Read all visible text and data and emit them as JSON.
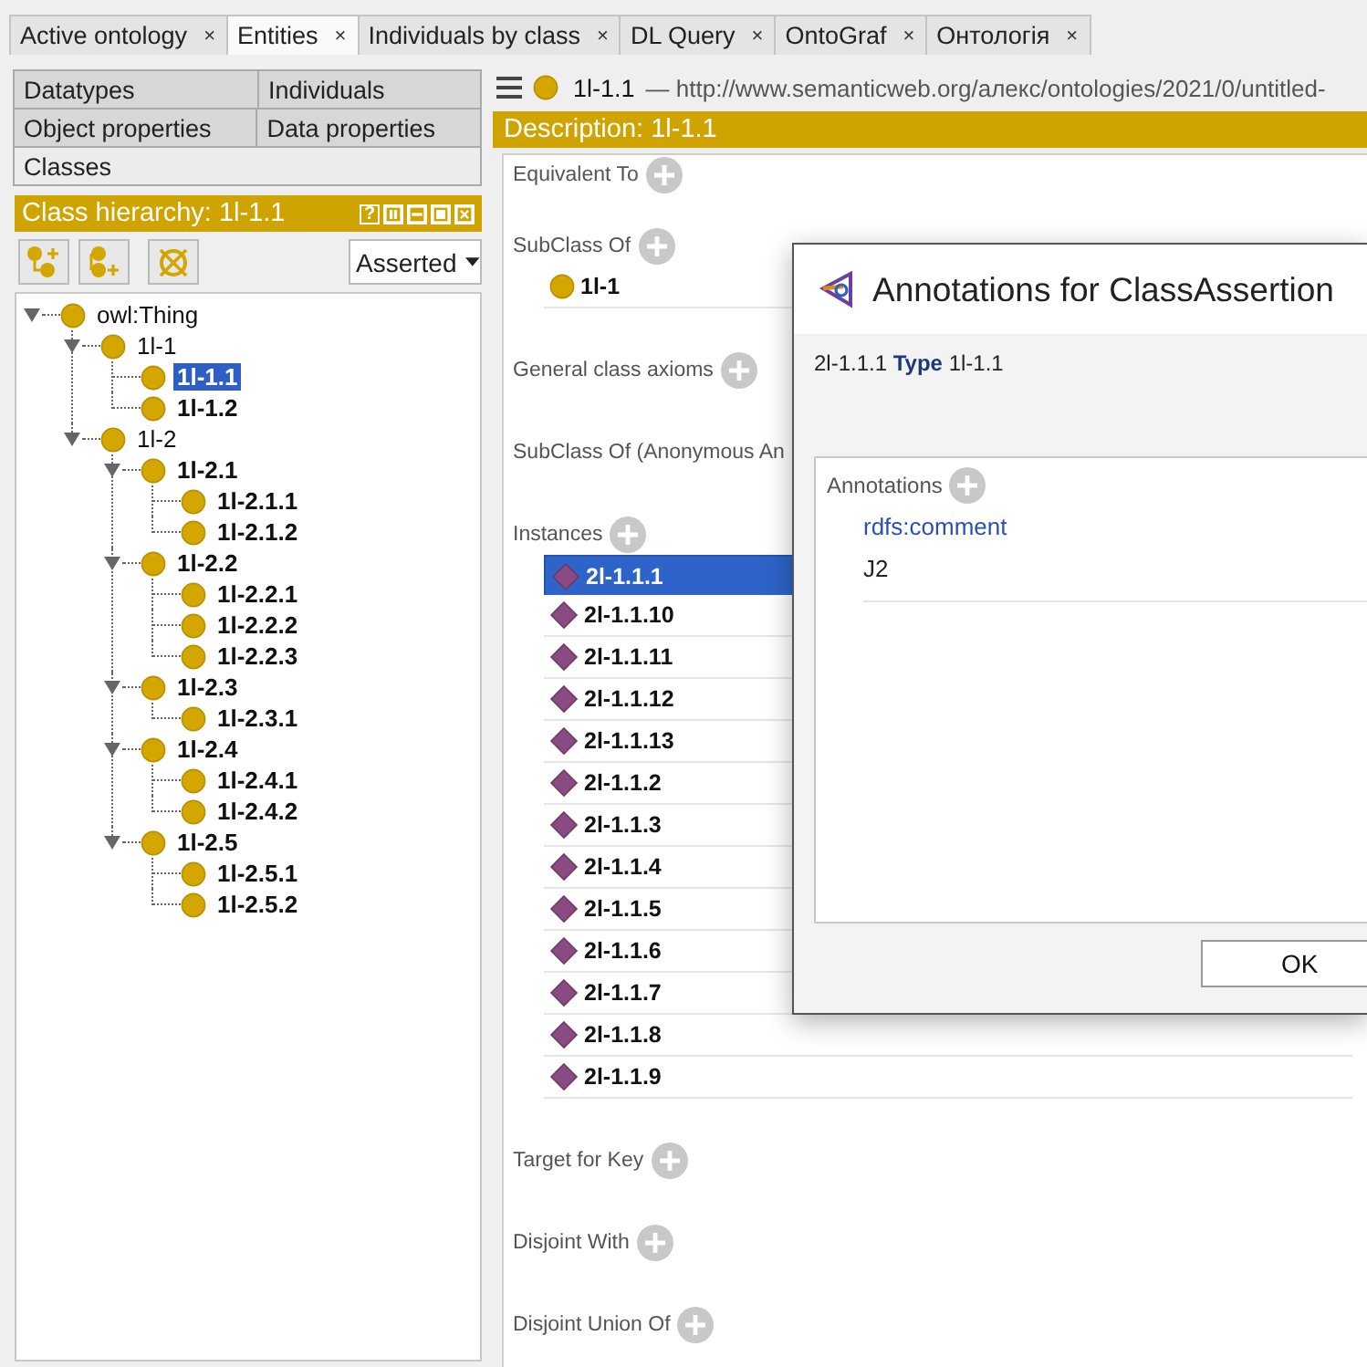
{
  "tabs": [
    {
      "label": "Active ontology",
      "close": "×",
      "selected": false
    },
    {
      "label": "Entities",
      "close": "×",
      "selected": true
    },
    {
      "label": "Individuals by class",
      "close": "×",
      "selected": false
    },
    {
      "label": "DL Query",
      "close": "×",
      "selected": false
    },
    {
      "label": "OntoGraf",
      "close": "×",
      "selected": false
    },
    {
      "label": "Онтологія",
      "close": "×",
      "selected": false
    }
  ],
  "entity_tabs": [
    {
      "tabs": [
        {
          "label": "Datatypes",
          "selected": false
        },
        {
          "label": "Individuals",
          "selected": false
        }
      ]
    },
    {
      "tabs": [
        {
          "label": "Object properties",
          "selected": false
        },
        {
          "label": "Data properties",
          "selected": false
        }
      ]
    },
    {
      "tabs": [
        {
          "label": "Classes",
          "selected": true
        }
      ]
    }
  ],
  "class_hierarchy": {
    "title": "Class hierarchy: 1l-1.1",
    "help_button": "?",
    "mode": "Asserted",
    "tree": [
      {
        "label": "owl:Thing",
        "bold": false,
        "selected": false,
        "expanded": true,
        "children": [
          {
            "label": "1l-1",
            "bold": false,
            "selected": false,
            "expanded": true,
            "children": [
              {
                "label": "1l-1.1",
                "bold": true,
                "selected": true
              },
              {
                "label": "1l-1.2",
                "bold": true,
                "selected": false
              }
            ]
          },
          {
            "label": "1l-2",
            "bold": false,
            "selected": false,
            "expanded": true,
            "children": [
              {
                "label": "1l-2.1",
                "bold": true,
                "selected": false,
                "expanded": true,
                "children": [
                  {
                    "label": "1l-2.1.1",
                    "bold": true,
                    "selected": false
                  },
                  {
                    "label": "1l-2.1.2",
                    "bold": true,
                    "selected": false
                  }
                ]
              },
              {
                "label": "1l-2.2",
                "bold": true,
                "selected": false,
                "expanded": true,
                "children": [
                  {
                    "label": "1l-2.2.1",
                    "bold": true,
                    "selected": false
                  },
                  {
                    "label": "1l-2.2.2",
                    "bold": true,
                    "selected": false
                  },
                  {
                    "label": "1l-2.2.3",
                    "bold": true,
                    "selected": false
                  }
                ]
              },
              {
                "label": "1l-2.3",
                "bold": true,
                "selected": false,
                "expanded": true,
                "children": [
                  {
                    "label": "1l-2.3.1",
                    "bold": true,
                    "selected": false
                  }
                ]
              },
              {
                "label": "1l-2.4",
                "bold": true,
                "selected": false,
                "expanded": true,
                "children": [
                  {
                    "label": "1l-2.4.1",
                    "bold": true,
                    "selected": false
                  },
                  {
                    "label": "1l-2.4.2",
                    "bold": true,
                    "selected": false
                  }
                ]
              },
              {
                "label": "1l-2.5",
                "bold": true,
                "selected": false,
                "expanded": true,
                "children": [
                  {
                    "label": "1l-2.5.1",
                    "bold": true,
                    "selected": false
                  },
                  {
                    "label": "1l-2.5.2",
                    "bold": true,
                    "selected": false
                  }
                ]
              }
            ]
          }
        ]
      }
    ]
  },
  "entity_header": {
    "name": "1l-1.1",
    "separator": "—",
    "iri": "http://www.semanticweb.org/алекс/ontologies/2021/0/untitled-"
  },
  "description": {
    "title": "Description: 1l-1.1",
    "sections": [
      {
        "label": "Equivalent To",
        "add": true
      },
      {
        "label": "SubClass Of",
        "add": true,
        "items": [
          {
            "kind": "class",
            "label": "1l-1",
            "selected": false
          }
        ]
      },
      {
        "label": "General class axioms",
        "add": true
      },
      {
        "label": "SubClass Of (Anonymous An",
        "add": false
      },
      {
        "label": "Instances",
        "add": true,
        "items": [
          {
            "kind": "individual",
            "label": "2l-1.1.1",
            "selected": true
          },
          {
            "kind": "individual",
            "label": "2l-1.1.10",
            "selected": false
          },
          {
            "kind": "individual",
            "label": "2l-1.1.11",
            "selected": false
          },
          {
            "kind": "individual",
            "label": "2l-1.1.12",
            "selected": false
          },
          {
            "kind": "individual",
            "label": "2l-1.1.13",
            "selected": false
          },
          {
            "kind": "individual",
            "label": "2l-1.1.2",
            "selected": false
          },
          {
            "kind": "individual",
            "label": "2l-1.1.3",
            "selected": false
          },
          {
            "kind": "individual",
            "label": "2l-1.1.4",
            "selected": false
          },
          {
            "kind": "individual",
            "label": "2l-1.1.5",
            "selected": false
          },
          {
            "kind": "individual",
            "label": "2l-1.1.6",
            "selected": false
          },
          {
            "kind": "individual",
            "label": "2l-1.1.7",
            "selected": false
          },
          {
            "kind": "individual",
            "label": "2l-1.1.8",
            "selected": false
          },
          {
            "kind": "individual",
            "label": "2l-1.1.9",
            "selected": false
          }
        ]
      },
      {
        "label": "Target for Key",
        "add": true
      },
      {
        "label": "Disjoint With",
        "add": true
      },
      {
        "label": "Disjoint Union Of",
        "add": true
      }
    ]
  },
  "dialog": {
    "title": "Annotations for ClassAssertion",
    "axiom": "2l-1.1.1 **Type** 1l-1.1",
    "annotations": {
      "label": "Annotations",
      "items": [
        {
          "property": "rdfs:comment",
          "value": "J2"
        }
      ]
    },
    "buttons": [
      "OK"
    ]
  }
}
